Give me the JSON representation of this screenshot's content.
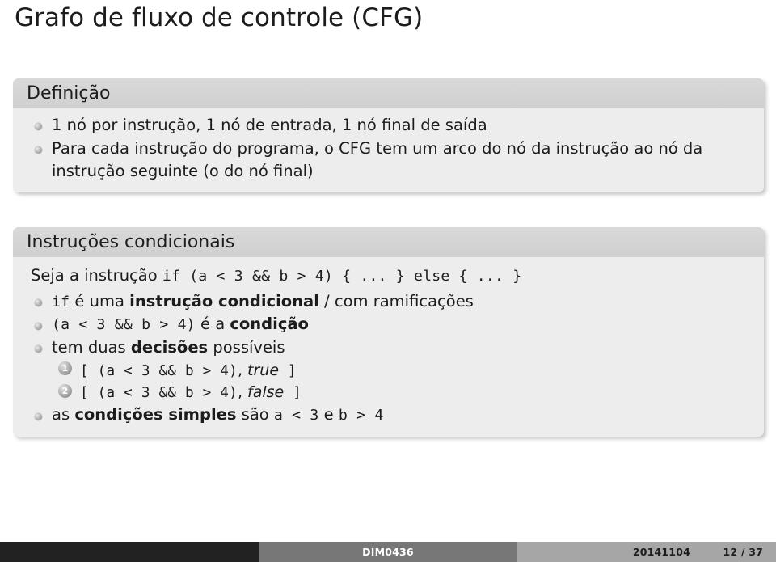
{
  "slide": {
    "title": "Grafo de fluxo de controle (CFG)",
    "blocks": [
      {
        "name": "definicao",
        "title": "Definição",
        "items": [
          "1 nó por instrução, 1 nó de entrada, 1 nó final de saída",
          "Para cada instrução do programa, o CFG tem um arco do nó da instrução ao nó da instrução seguinte (o do nó final)"
        ]
      },
      {
        "name": "condicionais",
        "title": "Instruções condicionais",
        "lead": {
          "prefix": "Seja a instrução ",
          "code": "if (a < 3 && b > 4) { ... } else { ... }"
        },
        "items": [
          {
            "code_lead": "if",
            "text_a": " é uma ",
            "bold": "instrução condicional",
            "text_b": " / com ramificações"
          },
          {
            "code_lead": "(a < 3 && b > 4)",
            "text_a": " é a ",
            "bold": "condição",
            "text_b": ""
          },
          {
            "code_lead": "",
            "text_a": "tem duas ",
            "bold": "decisões",
            "text_b": " possíveis",
            "sublist": [
              {
                "num": "1",
                "open": "[ ",
                "code": "(a < 3 && b > 4)",
                "comma": ", ",
                "value": "true",
                "close": " ]"
              },
              {
                "num": "2",
                "open": "[ ",
                "code": "(a < 3 && b > 4)",
                "comma": ", ",
                "value": "false",
                "close": " ]"
              }
            ]
          },
          {
            "code_lead": "",
            "text_a": "as ",
            "bold": "condições simples",
            "text_b": " são ",
            "code_mid": "a < 3",
            "text_c": " e ",
            "code_end": "b > 4"
          }
        ]
      }
    ]
  },
  "footer": {
    "course": "DIM0436",
    "date": "20141104",
    "page": "12 / 37"
  },
  "colors": {
    "block_title_bg": "#d5d5d5",
    "block_body_bg": "#ededed",
    "footer_left": "#222222",
    "footer_mid": "#777777",
    "footer_right": "#a6a6a6",
    "text": "#1c1c1c"
  }
}
